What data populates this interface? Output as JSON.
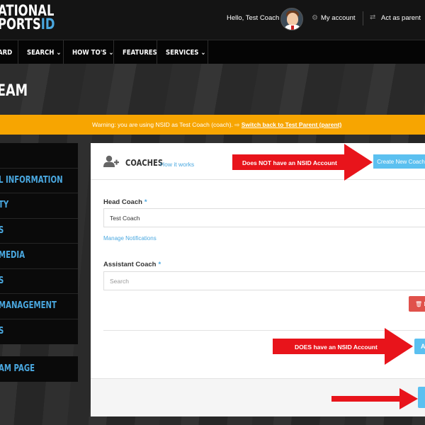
{
  "header": {
    "logo_line1": "ATIONAL",
    "logo_line2_a": "PORTS",
    "logo_line2_b": "ID",
    "hello": "Hello, Test Coach",
    "my_account": "My account",
    "act_as_parent": "Act as parent"
  },
  "nav": {
    "items": [
      {
        "label": "ARD"
      },
      {
        "label": "SEARCH ⌄"
      },
      {
        "label": "HOW TO'S ⌄"
      },
      {
        "label": "FEATURES"
      },
      {
        "label": "SERVICES ⌄"
      }
    ]
  },
  "hero": {
    "title": "EAM"
  },
  "warning": {
    "text": "Warning: you are using NSID as Test Coach (coach).",
    "link": "Switch back to Test Parent (parent)"
  },
  "sidebar": {
    "items": [
      {
        "label": "L INFORMATION"
      },
      {
        "label": "TY"
      },
      {
        "label": "S"
      },
      {
        "label": "MEDIA"
      },
      {
        "label": "S"
      },
      {
        "label": "MANAGEMENT"
      },
      {
        "label": "S"
      }
    ],
    "team_page": "AM PAGE"
  },
  "panel": {
    "title": "COACHES",
    "how_it_works": "How it works",
    "create_button": "Create New Coach",
    "head_coach_label": "Head Coach",
    "required_mark": "*",
    "head_coach_value": "Test Coach",
    "manage_notifications": "Manage Notifications",
    "assistant_coach_label": "Assistant Coach",
    "search_placeholder": "Search",
    "delete_label": "🗑 D",
    "add_label": "A"
  },
  "annotations": {
    "top": "Does NOT have an NSID Account",
    "middle": "DOES have an NSID Account"
  },
  "colors": {
    "accent": "#4aa8e0",
    "warning": "#f7a501",
    "button": "#5bc0f0",
    "danger": "#e0514b",
    "arrow": "#e8141b"
  }
}
